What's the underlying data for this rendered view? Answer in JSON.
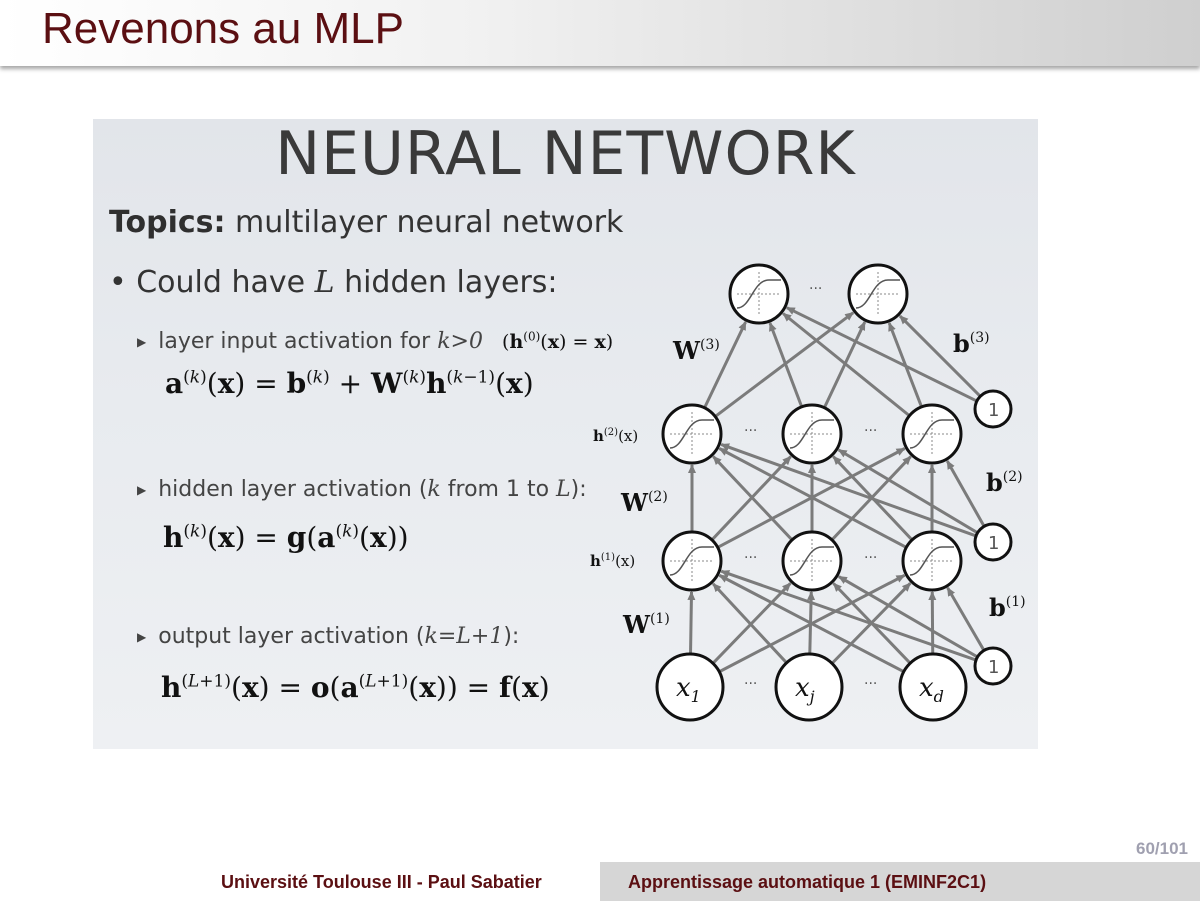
{
  "slide": {
    "title": "Revenons au MLP",
    "page_number": "60/101"
  },
  "image": {
    "heading": "NEURAL NETWORK",
    "topics_label": "Topics:",
    "topics_text": " multilayer neural network",
    "bullet_prefix": "Could have ",
    "bullet_var": "L",
    "bullet_suffix": " hidden layers:",
    "sub1_text": "layer input activation for ",
    "sub1_cond": "k>0",
    "sub2_text": "hidden layer activation (",
    "sub2_k": "k",
    "sub2_mid": " from 1 to ",
    "sub2_L": "L",
    "sub2_end": "):",
    "sub3_text": "output layer activation (",
    "sub3_cond": "k=L+1",
    "sub3_end": "):",
    "labels": {
      "W3": "W",
      "W3_sup": "(3)",
      "W2": "W",
      "W2_sup": "(2)",
      "W1": "W",
      "W1_sup": "(1)",
      "b3": "b",
      "b3_sup": "(3)",
      "b2": "b",
      "b2_sup": "(2)",
      "b1": "b",
      "b1_sup": "(1)",
      "h2": "h",
      "h2_sup": "(2)",
      "h2_arg": "(x)",
      "h1": "h",
      "h1_sup": "(1)",
      "h1_arg": "(x)",
      "bias_one": "1",
      "ellipsis": "...",
      "x1": "x",
      "x1_sub": "1",
      "xj": "x",
      "xj_sub": "j",
      "xd": "x",
      "xd_sub": "d"
    }
  },
  "footer": {
    "left": "Université Toulouse III - Paul Sabatier",
    "right": "Apprentissage automatique 1 (EMINF2C1)"
  }
}
